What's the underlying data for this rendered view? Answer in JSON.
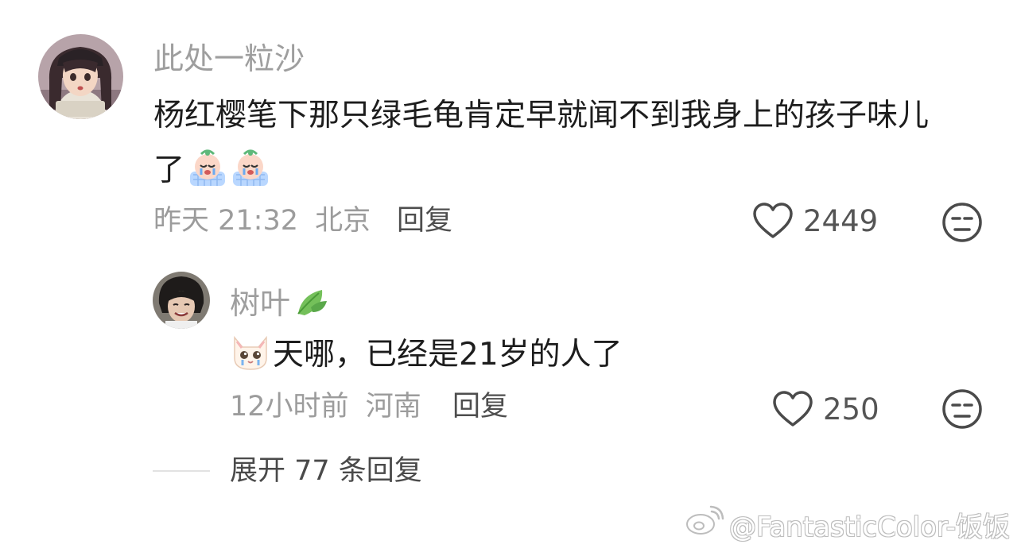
{
  "comment": {
    "username": "此处一粒沙",
    "text_line1": "杨红樱笔下那只绿毛龟肯定早就闻不到我身上的孩子味儿",
    "text_line2": "了",
    "emojis": [
      "crying-baby-emoji",
      "crying-baby-emoji"
    ],
    "time": "昨天 21:32",
    "location": "北京",
    "reply_label": "回复",
    "likes": "2449"
  },
  "reply": {
    "username": "树叶",
    "name_icon": "leaf-icon",
    "emoji": "crying-cat-emoji",
    "text": "天哪，已经是21岁的人了",
    "time": "12小时前",
    "location": "河南",
    "reply_label": "回复",
    "likes": "250"
  },
  "expand_label": "展开 77 条回复",
  "watermark": "@FantasticColor-饭饭",
  "colors": {
    "username": "#9e9e9e",
    "text": "#1d1d1d",
    "meta": "#9c9c9c",
    "icon": "#4a4a4a"
  }
}
